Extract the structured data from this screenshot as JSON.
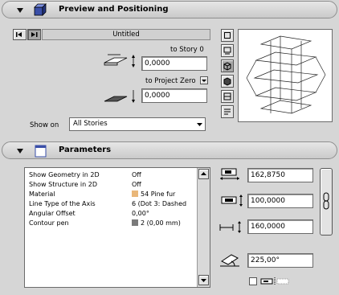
{
  "preview": {
    "title": "Preview and Positioning",
    "layer_name": "Untitled",
    "to_story_label": "to Story 0",
    "top_offset": "0,0000",
    "to_project_zero_label": "to Project Zero",
    "bottom_offset": "0,0000",
    "show_on_label": "Show on",
    "show_on_value": "All Stories"
  },
  "parameters": {
    "title": "Parameters",
    "rows": [
      {
        "name": "Show Geometry in 2D",
        "value": "Off"
      },
      {
        "name": "Show Structure in 2D",
        "value": "Off"
      },
      {
        "name": "Material",
        "value": "54 Pine fur",
        "swatch": "#e9b77a"
      },
      {
        "name": "Line Type of the Axis",
        "value": "6 (Dot 3: Dashed"
      },
      {
        "name": "Angular Offset",
        "value": "0,00°"
      },
      {
        "name": "Contour pen",
        "value": "2 (0,00 mm)",
        "swatch": "#7a7a7a"
      }
    ],
    "width_value": "162,8750",
    "depth_value": "100,0000",
    "height_value": "160,0000",
    "angle_value": "225,00°"
  },
  "colors": {
    "accent": "#3a4fa8",
    "panel": "#d6d6d6"
  }
}
